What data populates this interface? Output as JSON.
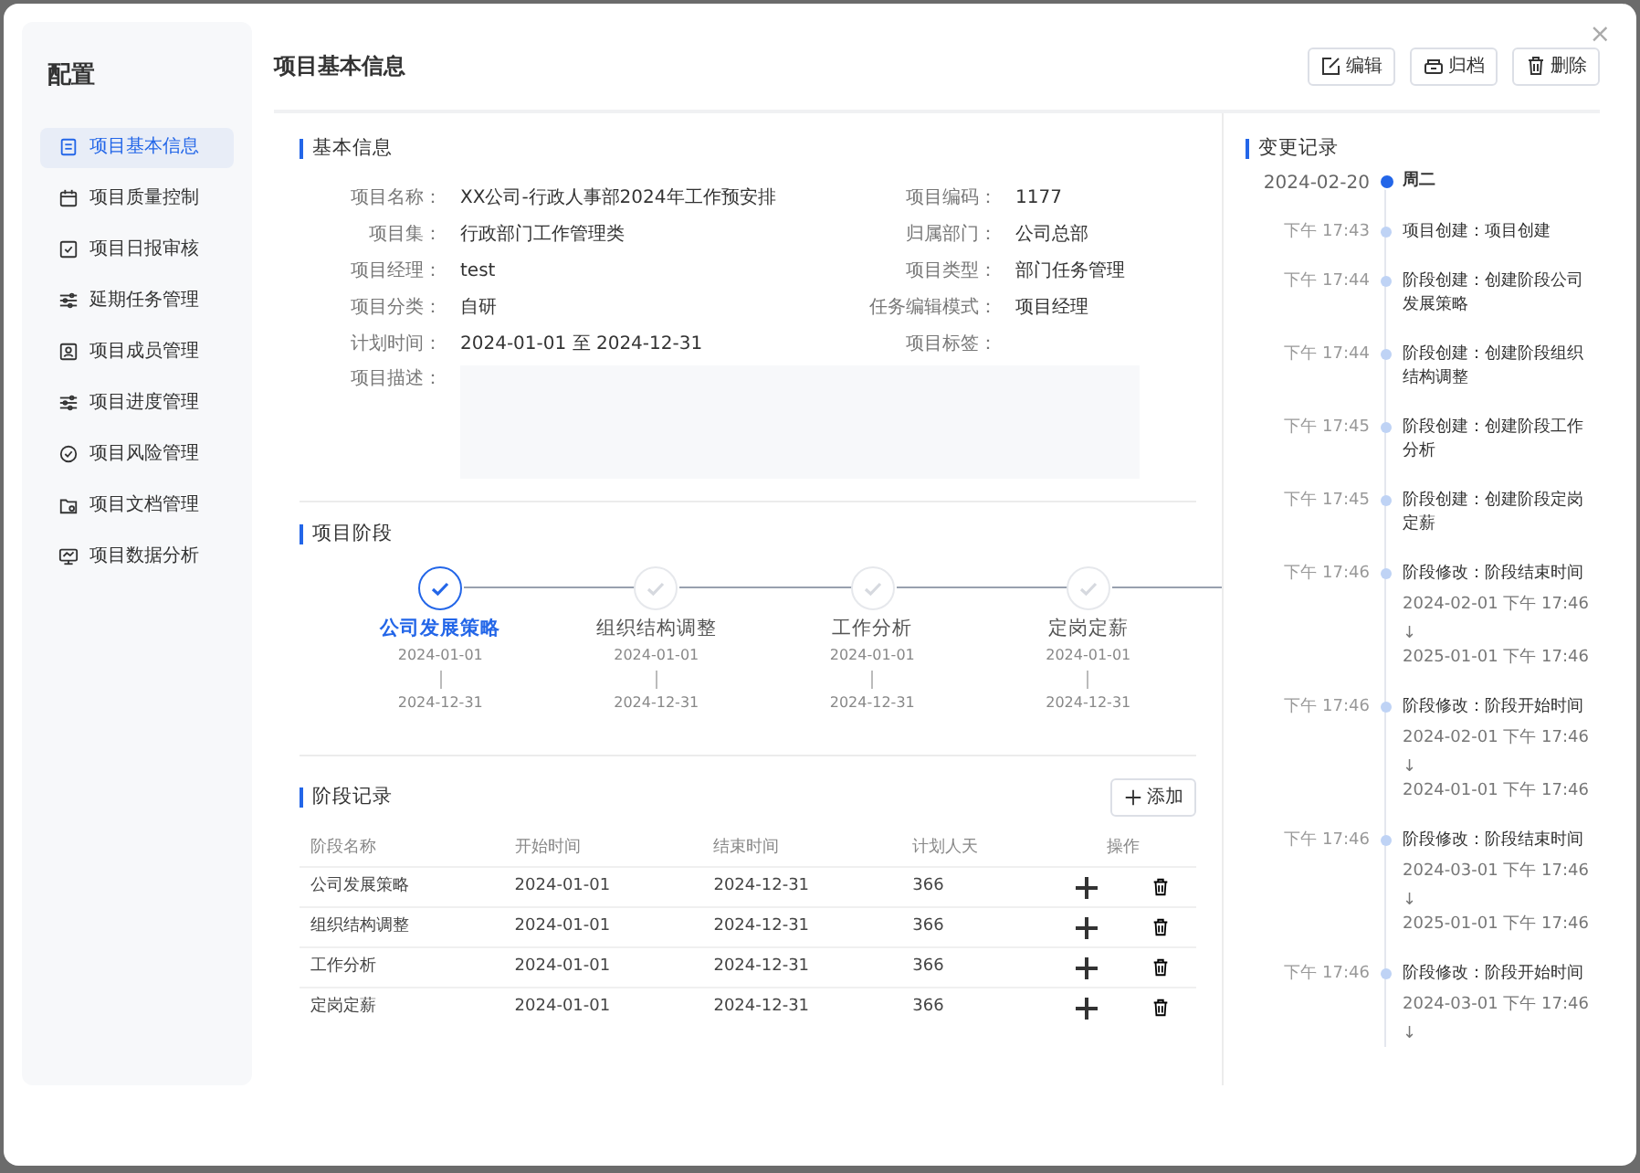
{
  "sidebar": {
    "title": "配置",
    "items": [
      {
        "label": "项目基本信息",
        "selected": true
      },
      {
        "label": "项目质量控制",
        "selected": false
      },
      {
        "label": "项目日报审核",
        "selected": false
      },
      {
        "label": "延期任务管理",
        "selected": false
      },
      {
        "label": "项目成员管理",
        "selected": false
      },
      {
        "label": "项目进度管理",
        "selected": false
      },
      {
        "label": "项目风险管理",
        "selected": false
      },
      {
        "label": "项目文档管理",
        "selected": false
      },
      {
        "label": "项目数据分析",
        "selected": false
      }
    ]
  },
  "header": {
    "title": "项目基本信息",
    "buttons": [
      "编辑",
      "归档",
      "删除"
    ]
  },
  "basic_info": {
    "title": "基本信息",
    "fields": [
      {
        "label": "项目名称：",
        "value": "XX公司-行政人事部2024年工作预安排"
      },
      {
        "label": "项目编码：",
        "value": "1177"
      },
      {
        "label": "项目集：",
        "value": "行政部门工作管理类"
      },
      {
        "label": "归属部门：",
        "value": "公司总部"
      },
      {
        "label": "项目经理：",
        "value": "test"
      },
      {
        "label": "项目类型：",
        "value": "部门任务管理"
      },
      {
        "label": "项目分类：",
        "value": "自研"
      },
      {
        "label": "任务编辑模式：",
        "value": "项目经理"
      },
      {
        "label": "计划时间：",
        "value": "2024-01-01 至 2024-12-31"
      },
      {
        "label": "项目标签："
      }
    ],
    "description_label": "项目描述："
  },
  "stages": {
    "title": "项目阶段",
    "steps": [
      {
        "name": "公司发展策略",
        "start": "2024-01-01",
        "end": "2024-12-31",
        "selected": true
      },
      {
        "name": "组织结构调整",
        "start": "2024-01-01",
        "end": "2024-12-31",
        "selected": false
      },
      {
        "name": "工作分析",
        "start": "2024-01-01",
        "end": "2024-12-31",
        "selected": false
      },
      {
        "name": "定岗定薪",
        "start": "2024-01-01",
        "end": "2024-12-31",
        "selected": false
      }
    ]
  },
  "stage_records": {
    "title": "阶段记录",
    "add_button": "添加",
    "columns": [
      "阶段名称",
      "开始时间",
      "结束时间",
      "计划人天",
      "操作"
    ],
    "rows": [
      [
        "公司发展策略",
        "2024-01-01",
        "2024-12-31",
        "366"
      ],
      [
        "组织结构调整",
        "2024-01-01",
        "2024-12-31",
        "366"
      ],
      [
        "工作分析",
        "2024-01-01",
        "2024-12-31",
        "366"
      ],
      [
        "定岗定薪",
        "2024-01-01",
        "2024-12-31",
        "366"
      ]
    ]
  },
  "change_log": {
    "title": "变更记录",
    "date": "2024-02-20",
    "weekday": "周二",
    "entries": [
      {
        "kind": "create",
        "time": "下午 17:43",
        "text": "项目创建：项目创建"
      },
      {
        "kind": "create",
        "time": "下午 17:44",
        "text": "阶段创建：创建阶段公司发展策略"
      },
      {
        "kind": "create",
        "time": "下午 17:44",
        "text": "阶段创建：创建阶段组织结构调整"
      },
      {
        "kind": "create",
        "time": "下午 17:45",
        "text": "阶段创建：创建阶段工作分析"
      },
      {
        "kind": "create",
        "time": "下午 17:45",
        "text": "阶段创建：创建阶段定岗定薪"
      },
      {
        "kind": "modify",
        "time": "下午 17:46",
        "text": "阶段修改：阶段结束时间",
        "from": "2024-02-01 下午 17:46",
        "arrow": "↓",
        "to": "2025-01-01 下午 17:46"
      },
      {
        "kind": "modify",
        "time": "下午 17:46",
        "text": "阶段修改：阶段开始时间",
        "from": "2024-02-01 下午 17:46",
        "arrow": "↓",
        "to": "2024-01-01 下午 17:46"
      },
      {
        "kind": "modify",
        "time": "下午 17:46",
        "text": "阶段修改：阶段结束时间",
        "from": "2024-03-01 下午 17:46",
        "arrow": "↓",
        "to": "2025-01-01 下午 17:46"
      },
      {
        "kind": "modify",
        "time": "下午 17:46",
        "text": "阶段修改：阶段开始时间",
        "from": "2024-03-01 下午 17:46",
        "arrow": "↓"
      }
    ]
  },
  "close_button": "×"
}
